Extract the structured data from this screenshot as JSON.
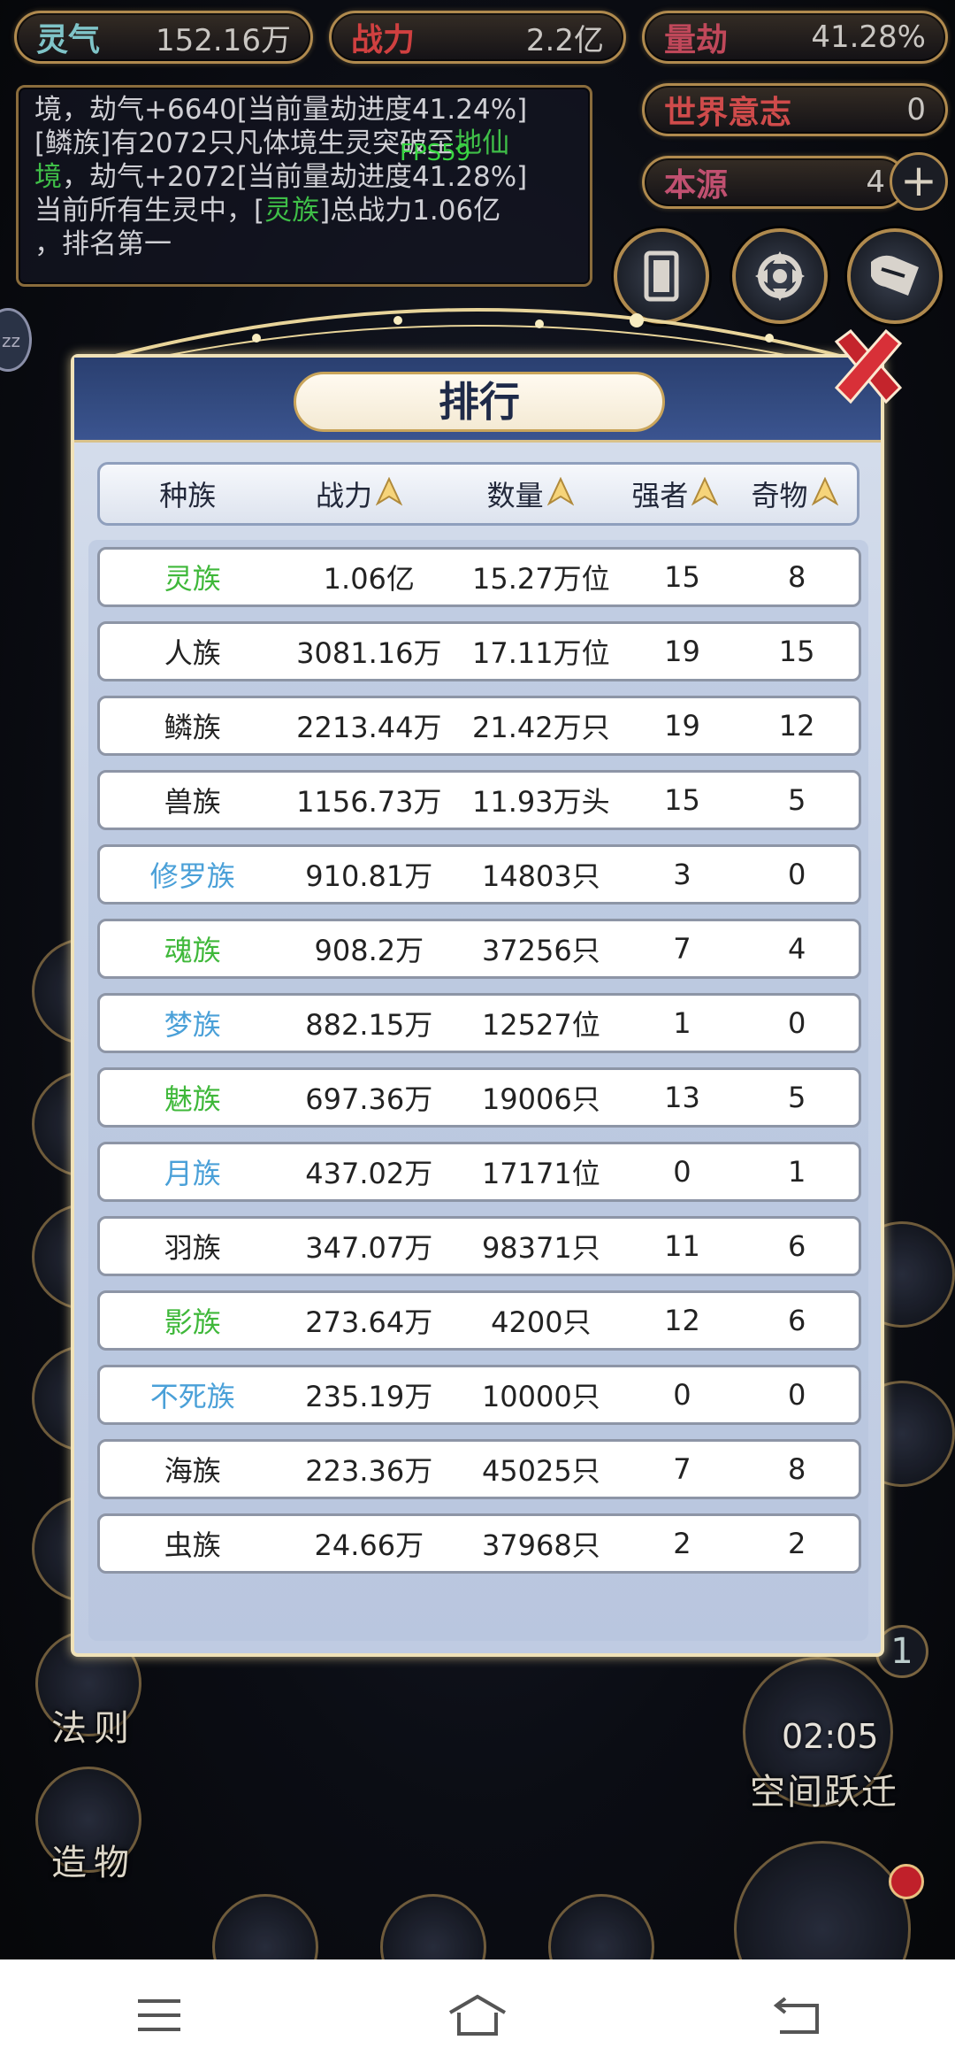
{
  "stats": {
    "qi": {
      "label": "灵气",
      "value": "152.16万"
    },
    "zhanli": {
      "label": "战力",
      "value": "2.2亿"
    },
    "liangjie": {
      "label": "量劫",
      "value": "41.28%"
    },
    "shijie": {
      "label": "世界意志",
      "value": "0"
    },
    "benyuan": {
      "label": "本源",
      "value": "4"
    }
  },
  "log": {
    "line1_a": "境，劫气+6640[当前量劫进度41.24%]",
    "line2_a": "[鳞族]有2072只凡体境生灵突破至",
    "line2_b": "地仙",
    "line3_a": "境",
    "line3_b": "，劫气+2072[当前量劫进度41.28%]",
    "line4_a": "当前所有生灵中，[",
    "line4_b": "灵族",
    "line4_c": "]总战力1.06亿",
    "line5": "，排名第一"
  },
  "fps": "FPS59",
  "zz": "zz",
  "modal": {
    "title": "排行",
    "columns": [
      "种族",
      "战力",
      "数量",
      "强者",
      "奇物"
    ],
    "sort_icon": "arrow-up-icon",
    "rows": [
      {
        "race": "灵族",
        "power": "1.06亿",
        "count": "15.27万位",
        "strong": "15",
        "items": "8",
        "color": "green"
      },
      {
        "race": "人族",
        "power": "3081.16万",
        "count": "17.11万位",
        "strong": "19",
        "items": "15",
        "color": "normal"
      },
      {
        "race": "鳞族",
        "power": "2213.44万",
        "count": "21.42万只",
        "strong": "19",
        "items": "12",
        "color": "normal"
      },
      {
        "race": "兽族",
        "power": "1156.73万",
        "count": "11.93万头",
        "strong": "15",
        "items": "5",
        "color": "normal"
      },
      {
        "race": "修罗族",
        "power": "910.81万",
        "count": "14803只",
        "strong": "3",
        "items": "0",
        "color": "blue"
      },
      {
        "race": "魂族",
        "power": "908.2万",
        "count": "37256只",
        "strong": "7",
        "items": "4",
        "color": "green"
      },
      {
        "race": "梦族",
        "power": "882.15万",
        "count": "12527位",
        "strong": "1",
        "items": "0",
        "color": "blue"
      },
      {
        "race": "魅族",
        "power": "697.36万",
        "count": "19006只",
        "strong": "13",
        "items": "5",
        "color": "green"
      },
      {
        "race": "月族",
        "power": "437.02万",
        "count": "17171位",
        "strong": "0",
        "items": "1",
        "color": "blue"
      },
      {
        "race": "羽族",
        "power": "347.07万",
        "count": "98371只",
        "strong": "11",
        "items": "6",
        "color": "normal"
      },
      {
        "race": "影族",
        "power": "273.64万",
        "count": "4200只",
        "strong": "12",
        "items": "6",
        "color": "green"
      },
      {
        "race": "不死族",
        "power": "235.19万",
        "count": "10000只",
        "strong": "0",
        "items": "0",
        "color": "blue"
      },
      {
        "race": "海族",
        "power": "223.36万",
        "count": "45025只",
        "strong": "7",
        "items": "8",
        "color": "normal"
      },
      {
        "race": "虫族",
        "power": "24.66万",
        "count": "37968只",
        "strong": "2",
        "items": "2",
        "color": "normal"
      }
    ]
  },
  "side": {
    "faze": "法则",
    "zaowu": "造物",
    "timer": "02:05",
    "jump": "空间跃迁",
    "badge": "1"
  },
  "colors": {
    "green": "#3fb83a",
    "blue": "#4aa0d8",
    "gold": "#b08a4e"
  }
}
